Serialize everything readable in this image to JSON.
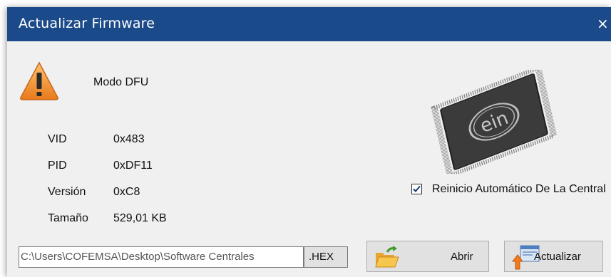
{
  "window": {
    "title": "Actualizar Firmware",
    "close_glyph": "×"
  },
  "device": {
    "mode": "Modo DFU",
    "fields": [
      {
        "label": "VID",
        "value": "0x483"
      },
      {
        "label": "PID",
        "value": "0xDF11"
      },
      {
        "label": "Versión",
        "value": "0xC8"
      },
      {
        "label": "Tamaño",
        "value": "529,01 KB"
      }
    ]
  },
  "options": {
    "auto_restart_label": "Reinicio Automático De La Central",
    "auto_restart_checked": true
  },
  "file": {
    "path": "C:\\Users\\COFEMSA\\Desktop\\Software Centrales",
    "extension": ".HEX"
  },
  "buttons": {
    "open_label": "Abrir",
    "update_label": "Actualizar"
  },
  "icons": {
    "warning": "warning-triangle-icon",
    "chip": "microcontroller-chip-icon",
    "open": "open-folder-icon",
    "update": "update-upload-icon"
  },
  "colors": {
    "titlebar": "#1b4a8a",
    "window_bg": "#f0f0f0",
    "warning": "#f29a2e"
  }
}
